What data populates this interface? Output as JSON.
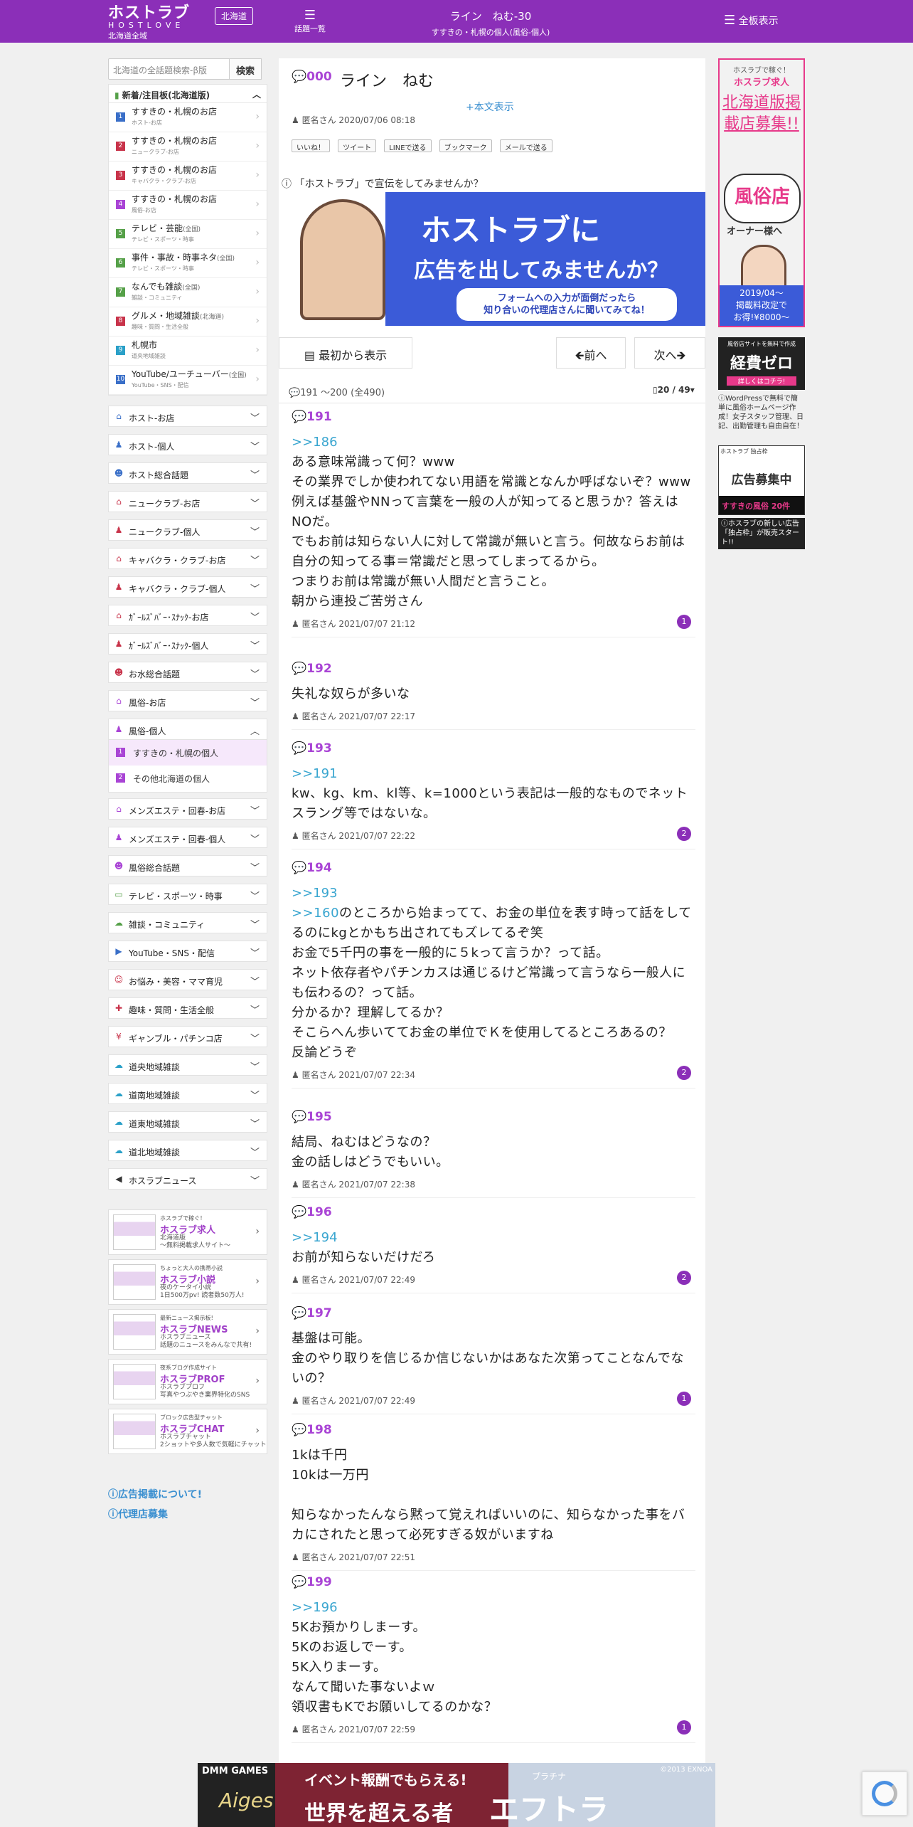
{
  "header": {
    "logo_jp": "ホストラブ",
    "logo_en": "HOSTLOVE",
    "region_sub": "北海道全域",
    "region_badge": "北海道",
    "topics_label": "話題一覧",
    "thread_title": "ライン　ねむ-30",
    "thread_sub": "すすきの・札幌の個人(風俗-個人)",
    "all_boards": "全板表示"
  },
  "search": {
    "placeholder": "北海道の全話題検索-β版",
    "button": "検索"
  },
  "ranking": {
    "title": "新着/注目板(北海道版)",
    "items": [
      {
        "n": "1",
        "title": "すすきの・札幌のお店",
        "sub": "ホスト-お店",
        "color": "#3a6fc8"
      },
      {
        "n": "2",
        "title": "すすきの・札幌のお店",
        "sub": "ニュークラブ-お店",
        "color": "#c8334a"
      },
      {
        "n": "3",
        "title": "すすきの・札幌のお店",
        "sub": "キャバクラ・クラブ-お店",
        "color": "#c8334a"
      },
      {
        "n": "4",
        "title": "すすきの・札幌のお店",
        "sub": "風俗-お店",
        "color": "#a944d5"
      },
      {
        "n": "5",
        "title": "テレビ・芸能",
        "tag": "(全国)",
        "sub": "テレビ・スポーツ・時事",
        "color": "#55a048"
      },
      {
        "n": "6",
        "title": "事件・事故・時事ネタ",
        "tag": "(全国)",
        "sub": "テレビ・スポーツ・時事",
        "color": "#55a048"
      },
      {
        "n": "7",
        "title": "なんでも雑談",
        "tag": "(全国)",
        "sub": "雑談・コミュニティ",
        "color": "#55a048"
      },
      {
        "n": "8",
        "title": "グルメ・地域雑談",
        "tag": "(北海道)",
        "sub": "趣味・質問・生活全般",
        "color": "#c8334a"
      },
      {
        "n": "9",
        "title": "札幌市",
        "sub": "道央地域雑談",
        "color": "#2aa0c8"
      },
      {
        "n": "10",
        "title": "YouTube/ユーチューバー",
        "tag": "(全国)",
        "sub": "YouTube・SNS・配信",
        "color": "#3a6fc8"
      }
    ]
  },
  "categories": [
    {
      "label": "ホスト-お店",
      "icon": "house-icon",
      "glyph": "⌂",
      "color": "#3a6fc8",
      "open": false
    },
    {
      "label": "ホスト-個人",
      "icon": "person-icon",
      "glyph": "♟",
      "color": "#3a6fc8",
      "open": false
    },
    {
      "label": "ホスト総合話題",
      "icon": "group-icon",
      "glyph": "☻",
      "color": "#3a6fc8",
      "open": false
    },
    {
      "label": "ニュークラブ-お店",
      "icon": "house-icon",
      "glyph": "⌂",
      "color": "#c8334a",
      "open": false
    },
    {
      "label": "ニュークラブ-個人",
      "icon": "person-icon",
      "glyph": "♟",
      "color": "#c8334a",
      "open": false
    },
    {
      "label": "キャバクラ・クラブ-お店",
      "icon": "house-icon",
      "glyph": "⌂",
      "color": "#c8334a",
      "open": false
    },
    {
      "label": "キャバクラ・クラブ-個人",
      "icon": "person-icon",
      "glyph": "♟",
      "color": "#c8334a",
      "open": false
    },
    {
      "label": "ｶﾞｰﾙｽﾞﾊﾞｰ･ｽﾅｯｸ-お店",
      "icon": "house-icon",
      "glyph": "⌂",
      "color": "#c8334a",
      "open": false
    },
    {
      "label": "ｶﾞｰﾙｽﾞﾊﾞｰ･ｽﾅｯｸ-個人",
      "icon": "person-icon",
      "glyph": "♟",
      "color": "#c8334a",
      "open": false
    },
    {
      "label": "お水総合話題",
      "icon": "group-icon",
      "glyph": "☻",
      "color": "#c8334a",
      "open": false
    },
    {
      "label": "風俗-お店",
      "icon": "house-icon",
      "glyph": "⌂",
      "color": "#a944d5",
      "open": false
    },
    {
      "label": "風俗-個人",
      "icon": "person-icon",
      "glyph": "♟",
      "color": "#a944d5",
      "open": true
    },
    {
      "label": "メンズエステ・回春-お店",
      "icon": "house-icon",
      "glyph": "⌂",
      "color": "#a944d5",
      "open": false
    },
    {
      "label": "メンズエステ・回春-個人",
      "icon": "person-icon",
      "glyph": "♟",
      "color": "#a944d5",
      "open": false
    },
    {
      "label": "風俗総合話題",
      "icon": "group-icon",
      "glyph": "☻",
      "color": "#a944d5",
      "open": false
    },
    {
      "label": "テレビ・スポーツ・時事",
      "icon": "tv-icon",
      "glyph": "▭",
      "color": "#55a048",
      "open": false
    },
    {
      "label": "雑談・コミュニティ",
      "icon": "chat-icon",
      "glyph": "☁",
      "color": "#55a048",
      "open": false
    },
    {
      "label": "YouTube・SNS・配信",
      "icon": "youtube-icon",
      "glyph": "▶",
      "color": "#3a6fc8",
      "open": false
    },
    {
      "label": "お悩み・美容・ママ育児",
      "icon": "face-icon",
      "glyph": "☺",
      "color": "#c8334a",
      "open": false
    },
    {
      "label": "趣味・質問・生活全般",
      "icon": "fork-icon",
      "glyph": "✚",
      "color": "#c8334a",
      "open": false
    },
    {
      "label": "ギャンブル・パチンコ店",
      "icon": "money-icon",
      "glyph": "¥",
      "color": "#c8334a",
      "open": false
    },
    {
      "label": "道央地域雑談",
      "icon": "chat-icon",
      "glyph": "☁",
      "color": "#2aa0c8",
      "open": false
    },
    {
      "label": "道南地域雑談",
      "icon": "chat-icon",
      "glyph": "☁",
      "color": "#2aa0c8",
      "open": false
    },
    {
      "label": "道東地域雑談",
      "icon": "chat-icon",
      "glyph": "☁",
      "color": "#2aa0c8",
      "open": false
    },
    {
      "label": "道北地域雑談",
      "icon": "chat-icon",
      "glyph": "☁",
      "color": "#2aa0c8",
      "open": false
    },
    {
      "label": "ホスラブニュース",
      "icon": "speaker-icon",
      "glyph": "◀",
      "color": "#333",
      "open": false
    }
  ],
  "fuzoku_sub": [
    {
      "n": "1",
      "label": "すすきの・札幌の個人"
    },
    {
      "n": "2",
      "label": "その他北海道の個人"
    }
  ],
  "banners": [
    {
      "tag": "ホスラブで稼ぐ！",
      "name": "ホスラブ求人",
      "sub": "北海道版\n〜無料掲載求人サイト〜"
    },
    {
      "tag": "ちょっと大人の携帯小説",
      "name": "ホスラブ小説",
      "sub": "夜のケータイ小説\n1日500万pv! 読者数50万人!"
    },
    {
      "tag": "最新ニュース掲示板!",
      "name": "ホスラブNEWS",
      "sub": "ホスラブニュース\n話題のニュースをみんなで共有!"
    },
    {
      "tag": "夜系ブログ作成サイト",
      "name": "ホスラブPROF",
      "sub": "ホスラブプロフ\n写真やつぶやき業界特化のSNS"
    },
    {
      "tag": "ブロック広告型チャット",
      "name": "ホスラブCHAT",
      "sub": "ホスラブチャット\n2ショットや多人数で気軽にチャット"
    }
  ],
  "footer_links": [
    "広告掲載について!",
    "代理店募集"
  ],
  "thread": {
    "no": "000",
    "name": "ライン　ねむ",
    "show_body": "+本文表示",
    "meta": "匿名さん 2020/07/06 08:18",
    "shares": [
      "いいね！",
      "ツイート",
      "LINEで送る",
      "ブックマーク",
      "メールで送る"
    ]
  },
  "ad_question": "「ホストラブ」で宣伝をしてみませんか？",
  "ad_banner": {
    "big": "ホストラブに",
    "mid": "広告を出してみませんか？",
    "small": "フォームへの入力が面倒だったら\n知り合いの代理店さんに聞いてみてね！"
  },
  "nav": {
    "first": "最初から表示",
    "prev": "前へ",
    "next": "次へ"
  },
  "range": "191 〜200 (全490)",
  "pager": "20 / 49",
  "posts": [
    {
      "no": "191",
      "anchor": ">>186",
      "text": "ある意味常識って何？www\nその業界でしか使われてない用語を常識となんか呼ばないぞ？www\n例えば基盤やNNって言葉を一般の人が知ってると思うか？答えはNOだ。\nでもお前は知らない人に対して常識が無いと言う。何故ならお前は自分の知ってる事＝常識だと思ってしまってるから。\nつまりお前は常識が無い人間だと言うこと。\n朝から連投ご苦労さん",
      "meta": "匿名さん 2021/07/07 21:12",
      "likes": "1"
    },
    {
      "no": "192",
      "anchor": "",
      "text": "失礼な奴らが多いな",
      "meta": "匿名さん 2021/07/07 22:17",
      "likes": ""
    },
    {
      "no": "193",
      "anchor": ">>191",
      "text": "kw、kg、km、kl等、k=1000という表記は一般的なものでネットスラング等ではないな。",
      "meta": "匿名さん 2021/07/07 22:22",
      "likes": "2"
    },
    {
      "no": "194",
      "anchor": ">>193",
      "anchor2": ">>160",
      "text": "のところから始まってて、お金の単位を表す時って話をしてるのにkgとかもち出されてもズレてるぞ笑\nお金で5千円の事を一般的に５kって言うか？って話。\nネット依存者やパチンカスは通じるけど常識って言うなら一般人にも伝わるの？って話。\n分かるか？理解してるか？\nそこらへん歩いててお金の単位でＫを使用してるところあるの？\n反論どうぞ",
      "meta": "匿名さん 2021/07/07 22:34",
      "likes": "2"
    },
    {
      "no": "195",
      "anchor": "",
      "text": "結局、ねむはどうなの？\n金の話しはどうでもいい。",
      "meta": "匿名さん 2021/07/07 22:38",
      "likes": ""
    },
    {
      "no": "196",
      "anchor": ">>194",
      "text": "お前が知らないだけだろ",
      "meta": "匿名さん 2021/07/07 22:49",
      "likes": "2"
    },
    {
      "no": "197",
      "anchor": "",
      "text": "基盤は可能。\n金のやり取りを信じるか信じないかはあなた次第ってことなんでないの？",
      "meta": "匿名さん 2021/07/07 22:49",
      "likes": "1"
    },
    {
      "no": "198",
      "anchor": "",
      "text": "1kは千円\n10kは一万円\n\n知らなかったんなら黙って覚えればいいのに、知らなかった事をバカにされたと思って必死すぎる奴がいますね",
      "meta": "匿名さん 2021/07/07 22:51",
      "likes": ""
    },
    {
      "no": "199",
      "anchor": ">>196",
      "text": "5Kお預かりしまーす。\n5Kのお返しでーす。\n5K入りまーす。\nなんて聞いた事ないよｗ\n領収書もKでお願いしてるのかな？",
      "meta": "匿名さん 2021/07/07 22:59",
      "likes": "1"
    }
  ],
  "right_ads": {
    "r1_top": "ホスラブで稼ぐ！",
    "r1_top2": "ホスラブ求人",
    "r1_title": "北海道版掲載店募集!!",
    "r1_badge": "風俗店",
    "r1_owner": "オーナー様へ",
    "r1_price": "2019/04〜\n掲載料改定で\nお得!¥8000〜",
    "r2_a": "風俗店サイトを無料で作成",
    "r2_b": "経費ゼロ",
    "r2_c": "詳しくはコチラ!",
    "r2_text": "WordPressで無料で簡単に風俗ホームページ作成！女子スタッフ管理、日記、出勤管理も自由自在！",
    "r3_a": "ホストラブ 独占枠",
    "r3_b": "広告募集中",
    "r3_c": "すすきの風俗 20件",
    "r3_text": "ホスラブの新しい広告「独占枠」が販売スタート!!"
  },
  "bottom_ad": {
    "dmm": "DMM GAMES",
    "aiges": "Aiges",
    "line1": "イベント報酬でもらえる!",
    "line2": "世界を超える者",
    "title": "エフトラ",
    "ruby": "プラチナ",
    "copy": "©2013 EXNOA"
  }
}
